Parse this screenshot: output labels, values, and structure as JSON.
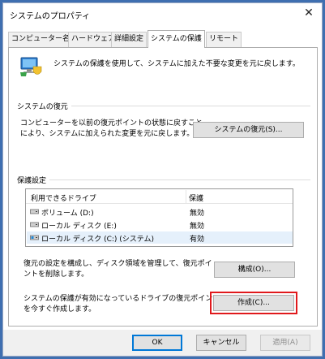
{
  "window": {
    "title": "システムのプロパティ",
    "close_glyph": "✕"
  },
  "tabs": [
    {
      "label": "コンピューター名",
      "active": false
    },
    {
      "label": "ハードウェア",
      "active": false
    },
    {
      "label": "詳細設定",
      "active": false
    },
    {
      "label": "システムの保護",
      "active": true
    },
    {
      "label": "リモート",
      "active": false
    }
  ],
  "intro": {
    "text": "システムの保護を使用して、システムに加えた不要な変更を元に戻します。",
    "icon": "computer-shield-icon"
  },
  "restore_section": {
    "title": "システムの復元",
    "description_line1": "コンピューターを以前の復元ポイントの状態に戻すこと",
    "description_line2": "により、システムに加えられた変更を元に戻します。",
    "button_label": "システムの復元(S)..."
  },
  "protection_section": {
    "title": "保護設定",
    "columns": [
      "利用できるドライブ",
      "保護"
    ],
    "drives": [
      {
        "name": "ボリューム (D:)",
        "status": "無効",
        "selected": false,
        "icon": "drive-icon"
      },
      {
        "name": "ローカル ディスク (E:)",
        "status": "無効",
        "selected": false,
        "icon": "drive-icon"
      },
      {
        "name": "ローカル ディスク (C:) (システム)",
        "status": "有効",
        "selected": true,
        "icon": "system-drive-icon"
      }
    ],
    "configure_text_line1": "復元の設定を構成し、ディスク領域を管理して、復元ポイ",
    "configure_text_line2": "ントを削除します。",
    "configure_button": "構成(O)...",
    "create_text_line1": "システムの保護が有効になっているドライブの復元ポイント",
    "create_text_line2": "を今すぐ作成します。",
    "create_button": "作成(C)...",
    "highlight_color": "#e0191c"
  },
  "footer": {
    "ok_label": "OK",
    "cancel_label": "キャンセル",
    "apply_label": "適用(A)"
  },
  "colors": {
    "accent": "#0078d7",
    "background": "#3f6fb0"
  }
}
